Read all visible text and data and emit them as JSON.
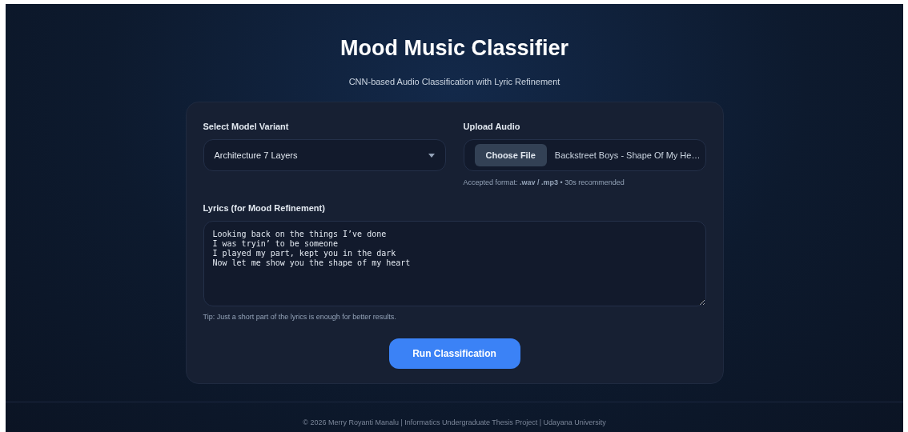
{
  "header": {
    "title": "Mood Music Classifier",
    "subtitle": "CNN-based Audio Classification with Lyric Refinement"
  },
  "model": {
    "label": "Select Model Variant",
    "value": "Architecture 7 Layers"
  },
  "upload": {
    "label": "Upload Audio",
    "button": "Choose File",
    "file_name": "Backstreet Boys - Shape Of My He…",
    "hint": "Accepted format: **.wav / .mp3** • 30s recommended"
  },
  "lyrics": {
    "label": "Lyrics (for Mood Refinement)",
    "value": "Looking back on the things I’ve done\nI was tryin’ to be someone\nI played my part, kept you in the dark\nNow let me show you the shape of my heart",
    "tip": "Tip: Just a short part of the lyrics is enough for better results."
  },
  "run_button": "Run Classification",
  "footer": "© 2026 Merry Royanti Manalu | Informatics Undergraduate Thesis Project | Udayana University"
}
